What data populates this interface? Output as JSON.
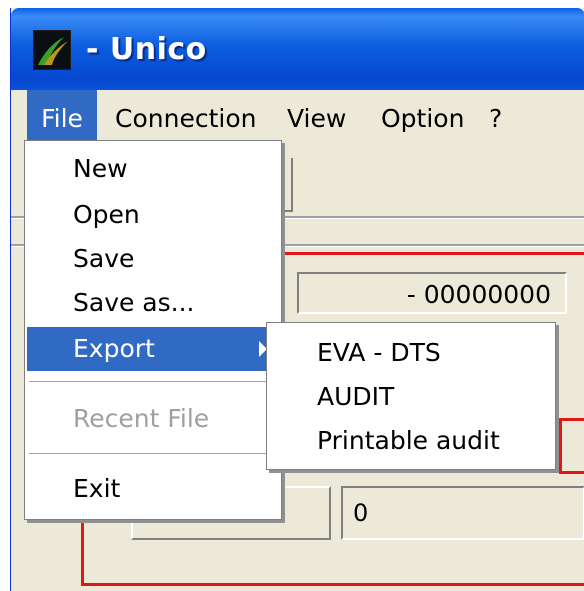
{
  "window": {
    "title": "- Unico",
    "icon": "app-logo-icon"
  },
  "menubar": {
    "items": [
      {
        "label": "File"
      },
      {
        "label": "Connection"
      },
      {
        "label": "View"
      },
      {
        "label": "Option"
      },
      {
        "label": "?"
      }
    ]
  },
  "file_menu": {
    "items": [
      {
        "label": "New"
      },
      {
        "label": "Open"
      },
      {
        "label": "Save"
      },
      {
        "label": "Save as..."
      },
      {
        "label": "Export"
      },
      {
        "label": "Recent File"
      },
      {
        "label": "Exit"
      }
    ]
  },
  "export_submenu": {
    "items": [
      {
        "label": "EVA - DTS"
      },
      {
        "label": "AUDIT"
      },
      {
        "label": "Printable audit"
      }
    ]
  },
  "fields": {
    "id_value": "- 00000000",
    "zero_value": "0"
  },
  "colors": {
    "titlebar": "#0a55dc",
    "selection": "#316ac5",
    "frame": "#e01818"
  }
}
